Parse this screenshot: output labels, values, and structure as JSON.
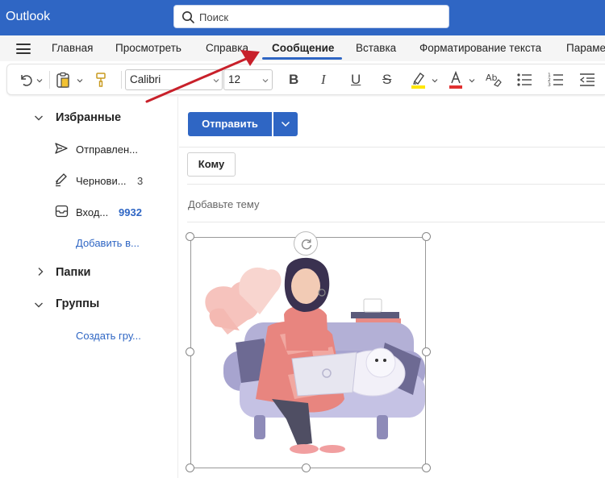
{
  "app": {
    "title": "Outlook"
  },
  "search": {
    "placeholder": "Поиск"
  },
  "tabs": [
    {
      "label": "Главная"
    },
    {
      "label": "Просмотреть"
    },
    {
      "label": "Справка"
    },
    {
      "label": "Сообщение",
      "active": true
    },
    {
      "label": "Вставка"
    },
    {
      "label": "Форматирование текста"
    },
    {
      "label": "Параме"
    }
  ],
  "ribbon": {
    "font_name": "Calibri",
    "font_size": "12",
    "bold": "B",
    "italic": "I",
    "underline": "U",
    "strike": "S"
  },
  "nav": {
    "favorites_label": "Избранные",
    "items": [
      {
        "label": "Отправлен...",
        "count": ""
      },
      {
        "label": "Чернови...",
        "count": "3"
      },
      {
        "label": "Вход...",
        "count": "9932"
      }
    ],
    "add_favorite": "Добавить в...",
    "folders_label": "Папки",
    "groups_label": "Группы",
    "create_group": "Создать гру..."
  },
  "compose": {
    "send_label": "Отправить",
    "to_label": "Кому",
    "subject_placeholder": "Добавьте тему"
  },
  "colors": {
    "brand": "#2f66c4",
    "annotation_arrow": "#c8202a",
    "highlight": "#ffe600",
    "font_color": "#e03030"
  }
}
